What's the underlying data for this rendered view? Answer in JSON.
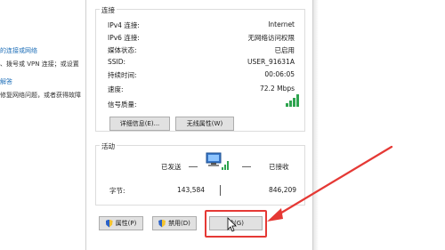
{
  "background": {
    "lines": [
      {
        "text": "的连接或网络",
        "kind": "link"
      },
      {
        "text": "、拨号或 VPN 连接；或设置",
        "kind": "text"
      },
      {
        "text": "解答",
        "kind": "link"
      },
      {
        "text": "修复网络问题，或者获得故障",
        "kind": "text"
      }
    ]
  },
  "dialog": {
    "connection_group": {
      "title": "连接",
      "rows": [
        {
          "key": "IPv4 连接:",
          "value": "Internet"
        },
        {
          "key": "IPv6 连接:",
          "value": "无网络访问权限"
        },
        {
          "key": "媒体状态:",
          "value": "已启用"
        },
        {
          "key": "SSID:",
          "value": "USER_91631A"
        },
        {
          "key": "持续时间:",
          "value": "00:06:05"
        },
        {
          "key": "速度:",
          "value": "72.2 Mbps"
        },
        {
          "key": "信号质量:",
          "value": ""
        }
      ],
      "signal_bars": 4
    },
    "buttons_top": {
      "details": "详细信息(E)...",
      "wireless_props": "无线属性(W)"
    },
    "activity_group": {
      "title": "活动",
      "sent_label": "已发送",
      "received_label": "已接收",
      "bytes_label": "字节:",
      "bytes_sent": "143,584",
      "bytes_received": "846,209"
    },
    "buttons_bottom": {
      "properties": "属性(P)",
      "disable": "禁用(D)",
      "diagnose": "诊(G)"
    }
  },
  "annotation": {
    "color": "#e53935"
  },
  "colors": {
    "link": "#1f6fb8",
    "signal": "#2ea44f",
    "button_bg": "#e1e1e1"
  }
}
